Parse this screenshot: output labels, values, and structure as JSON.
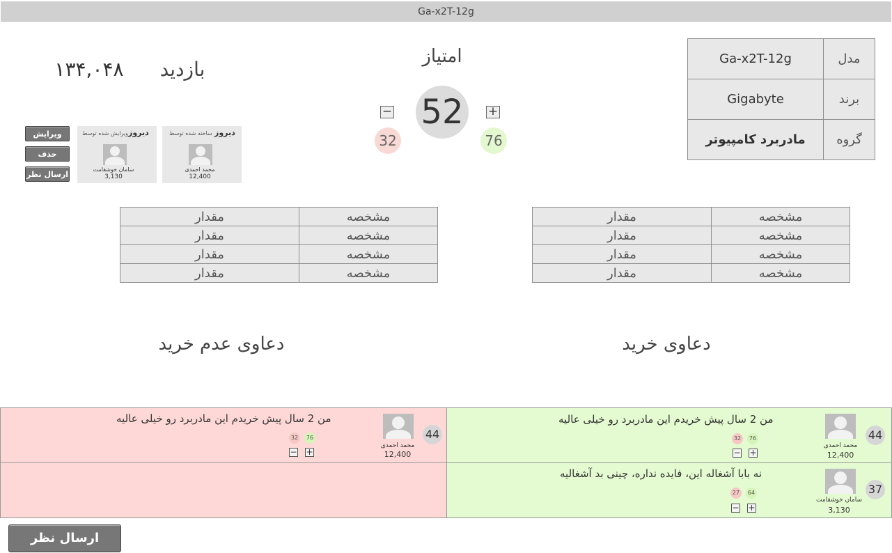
{
  "window": {
    "title": "Ga-x2T-12g"
  },
  "product_info": [
    {
      "label": "مدل",
      "value": "Ga-x2T-12g"
    },
    {
      "label": "برند",
      "value": "Gigabyte"
    },
    {
      "label": "گروه",
      "value": "مادربرد کامپیوتر"
    }
  ],
  "score": {
    "title": "امتیاز",
    "total": "52",
    "up": "76",
    "down": "32",
    "plus": "+",
    "minus": "−"
  },
  "visits": {
    "label": "بازدید",
    "count": "۱۳۴,۰۴۸"
  },
  "creators": [
    {
      "username": "دیروز",
      "caption": "ساخته شده توسط",
      "name": "محمد احمدی",
      "score": "12,400"
    },
    {
      "username": "دیروز",
      "caption": "ویرایش شده توسط",
      "name": "سامان خوشقامت",
      "score": "3,130"
    }
  ],
  "actions": {
    "edit": "ویرایش",
    "delete": "حذف",
    "comment": "ارسال نظر"
  },
  "specs_right": [
    {
      "key": "مشخصه",
      "value": "مقدار"
    },
    {
      "key": "مشخصه",
      "value": "مقدار"
    },
    {
      "key": "مشخصه",
      "value": "مقدار"
    },
    {
      "key": "مشخصه",
      "value": "مقدار"
    }
  ],
  "specs_left": [
    {
      "key": "مشخصه",
      "value": "مقدار"
    },
    {
      "key": "مشخصه",
      "value": "مقدار"
    },
    {
      "key": "مشخصه",
      "value": "مقدار"
    },
    {
      "key": "مشخصه",
      "value": "مقدار"
    }
  ],
  "claims": {
    "buy_title": "دعاوی خرید",
    "not_buy_title": "دعاوی عدم خرید",
    "buy": [
      {
        "score": "44",
        "name": "محمد احمدی",
        "user_score": "12,400",
        "text": "من 2 سال پیش خریدم این مادربرد رو خیلی عالیه",
        "up": "76",
        "down": "32"
      },
      {
        "score": "37",
        "name": "سامان خوشقامت",
        "user_score": "3,130",
        "text": "نه بابا آشغاله این، فایده نداره، چینی بد آشغالیه",
        "up": "64",
        "down": "27"
      }
    ],
    "not_buy": [
      {
        "score": "44",
        "name": "محمد احمدی",
        "user_score": "12,400",
        "text": "من 2 سال پیش خریدم این مادربرد رو خیلی عالیه",
        "up": "76",
        "down": "32"
      }
    ]
  },
  "footer": {
    "submit_comment": "ارسال نظر"
  },
  "colors": {
    "claim_buy_bg": "#e4fbd1",
    "claim_not_buy_bg": "#fdd8d6",
    "vote_up": "#e4f8cf",
    "vote_down": "#f8d9d4"
  }
}
